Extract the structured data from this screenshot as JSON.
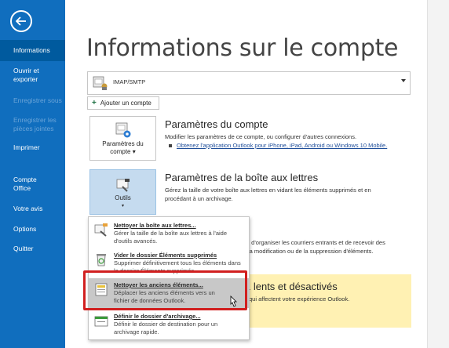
{
  "sidebar": {
    "items": [
      {
        "label": "Informations",
        "state": "active"
      },
      {
        "label": "Ouvrir et exporter",
        "state": "normal"
      },
      {
        "label": "Enregistrer sous",
        "state": "disabled"
      },
      {
        "label": "Enregistrer les pièces jointes",
        "state": "disabled"
      },
      {
        "label": "Imprimer",
        "state": "normal"
      },
      {
        "label": "Compte Office",
        "state": "normal"
      },
      {
        "label": "Votre avis",
        "state": "normal"
      },
      {
        "label": "Options",
        "state": "normal"
      },
      {
        "label": "Quitter",
        "state": "normal"
      }
    ]
  },
  "main": {
    "title": "Informations sur le compte",
    "account_select_value": "IMAP/SMTP",
    "add_account_label": "Ajouter un compte",
    "account_settings": {
      "tile_label": "Paramètres du compte ▾",
      "title": "Paramètres du compte",
      "text": "Modifier les paramètres de ce compte, ou configurer d'autres connexions.",
      "link": "Obtenez l'application Outlook pour iPhone, iPad, Android ou Windows 10 Mobile."
    },
    "mailbox_settings": {
      "tile_label": "Outils",
      "title": "Paramètres de la boîte aux lettres",
      "text": "Gérez la taille de votre boîte aux lettres en vidant les éléments supprimés et en procédant à un archivage."
    },
    "rules_text_line1": "t d'organiser les courriers entrants et de recevoir des",
    "rules_text_line2": "la modification ou de la suppression d'éléments.",
    "slow_addins": {
      "title": "1 lents et désactivés",
      "text": "qui affectent votre expérience Outlook."
    }
  },
  "menu": {
    "items": [
      {
        "title": "Nettoyer la boîte aux lettres...",
        "desc": "Gérer la taille de la boîte aux lettres à l'aide d'outils avancés."
      },
      {
        "title": "Vider le dossier Éléments supprimés",
        "desc": "Supprimer définitivement tous les éléments dans le dossier Éléments supprimés."
      },
      {
        "title": "Nettoyer les anciens éléments...",
        "desc": "Déplacer les anciens éléments vers un fichier de données Outlook."
      },
      {
        "title": "Définir le dossier d'archivage...",
        "desc": "Définir le dossier de destination pour un archivage rapide."
      }
    ]
  },
  "colors": {
    "sidebar": "#106ebe",
    "sidebar_active": "#005a9e",
    "highlight_border": "#d11f1f",
    "warning_band": "#fff1b3"
  }
}
